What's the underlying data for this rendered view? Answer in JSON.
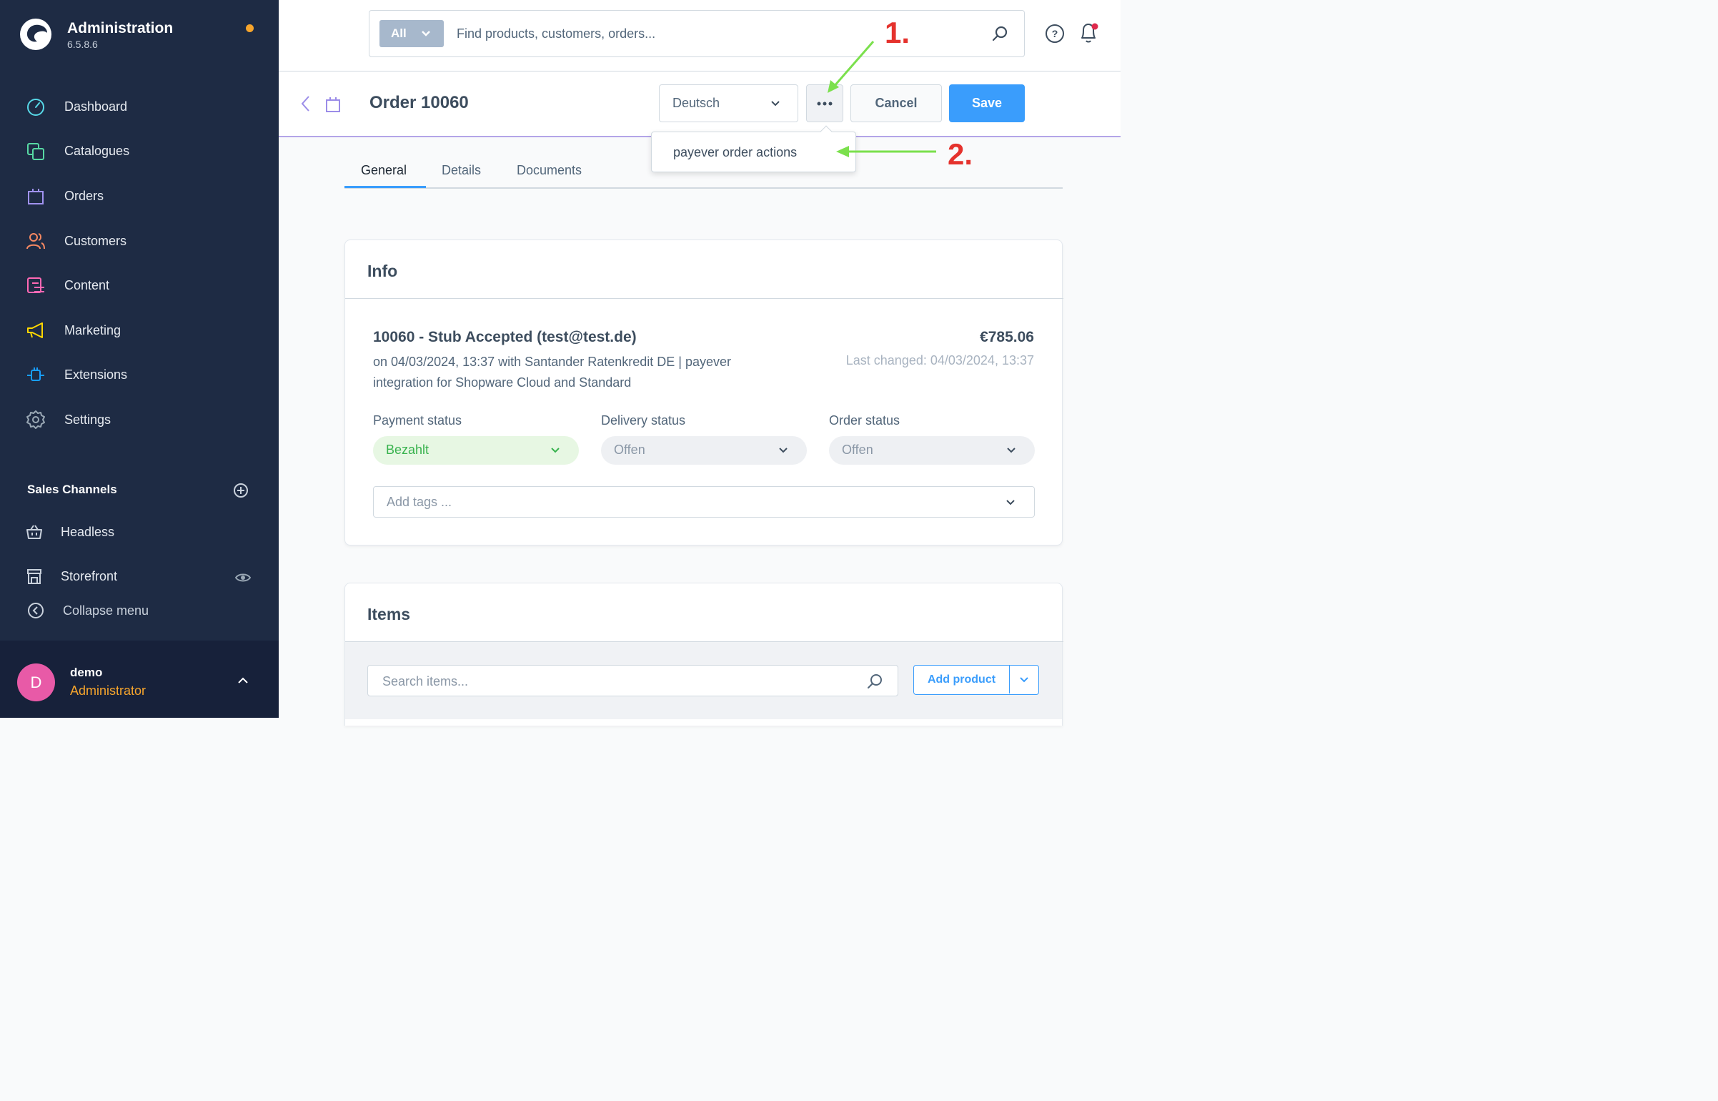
{
  "sidebar": {
    "title": "Administration",
    "version": "6.5.8.6",
    "nav": [
      {
        "label": "Dashboard",
        "icon": "dashboard-icon",
        "color": "#57d9e8"
      },
      {
        "label": "Catalogues",
        "icon": "catalogues-icon",
        "color": "#57d9a3"
      },
      {
        "label": "Orders",
        "icon": "orders-icon",
        "color": "#a092f0"
      },
      {
        "label": "Customers",
        "icon": "customers-icon",
        "color": "#f88962"
      },
      {
        "label": "Content",
        "icon": "content-icon",
        "color": "#ff68b4"
      },
      {
        "label": "Marketing",
        "icon": "marketing-icon",
        "color": "#ffd700"
      },
      {
        "label": "Extensions",
        "icon": "extensions-icon",
        "color": "#189eff"
      },
      {
        "label": "Settings",
        "icon": "settings-icon",
        "color": "#9aa8b5"
      }
    ],
    "sales_channels": {
      "title": "Sales Channels",
      "items": [
        {
          "label": "Headless",
          "icon": "basket-icon"
        },
        {
          "label": "Storefront",
          "icon": "storefront-icon"
        }
      ]
    },
    "collapse_label": "Collapse menu",
    "user": {
      "initial": "D",
      "name": "demo",
      "role": "Administrator"
    }
  },
  "topbar": {
    "search_type": "All",
    "search_placeholder": "Find products, customers, orders..."
  },
  "smartbar": {
    "title": "Order 10060",
    "language": "Deutsch",
    "cancel_label": "Cancel",
    "save_label": "Save"
  },
  "context_menu": {
    "item": "payever order actions"
  },
  "annotations": {
    "step1": "1.",
    "step2": "2."
  },
  "tabs": [
    {
      "label": "General",
      "active": true
    },
    {
      "label": "Details",
      "active": false
    },
    {
      "label": "Documents",
      "active": false
    }
  ],
  "info_card": {
    "title": "Info",
    "heading": "10060 - Stub Accepted (test@test.de)",
    "description": "on 04/03/2024, 13:37 with Santander Ratenkredit DE | payever integration for Shopware Cloud and Standard",
    "total": "€785.06",
    "last_changed": "Last changed: 04/03/2024, 13:37",
    "payment_status": {
      "label": "Payment status",
      "value": "Bezahlt"
    },
    "delivery_status": {
      "label": "Delivery status",
      "value": "Offen"
    },
    "order_status": {
      "label": "Order status",
      "value": "Offen"
    },
    "tags_placeholder": "Add tags ..."
  },
  "items_card": {
    "title": "Items",
    "search_placeholder": "Search items...",
    "add_product_label": "Add product"
  },
  "colors": {
    "sidebar_bg": "#1e2b44",
    "accent": "#3a9dfc",
    "notification_dot": "#f7a52c",
    "annotation_red": "#e5322d",
    "annotation_green": "#7be04d"
  }
}
